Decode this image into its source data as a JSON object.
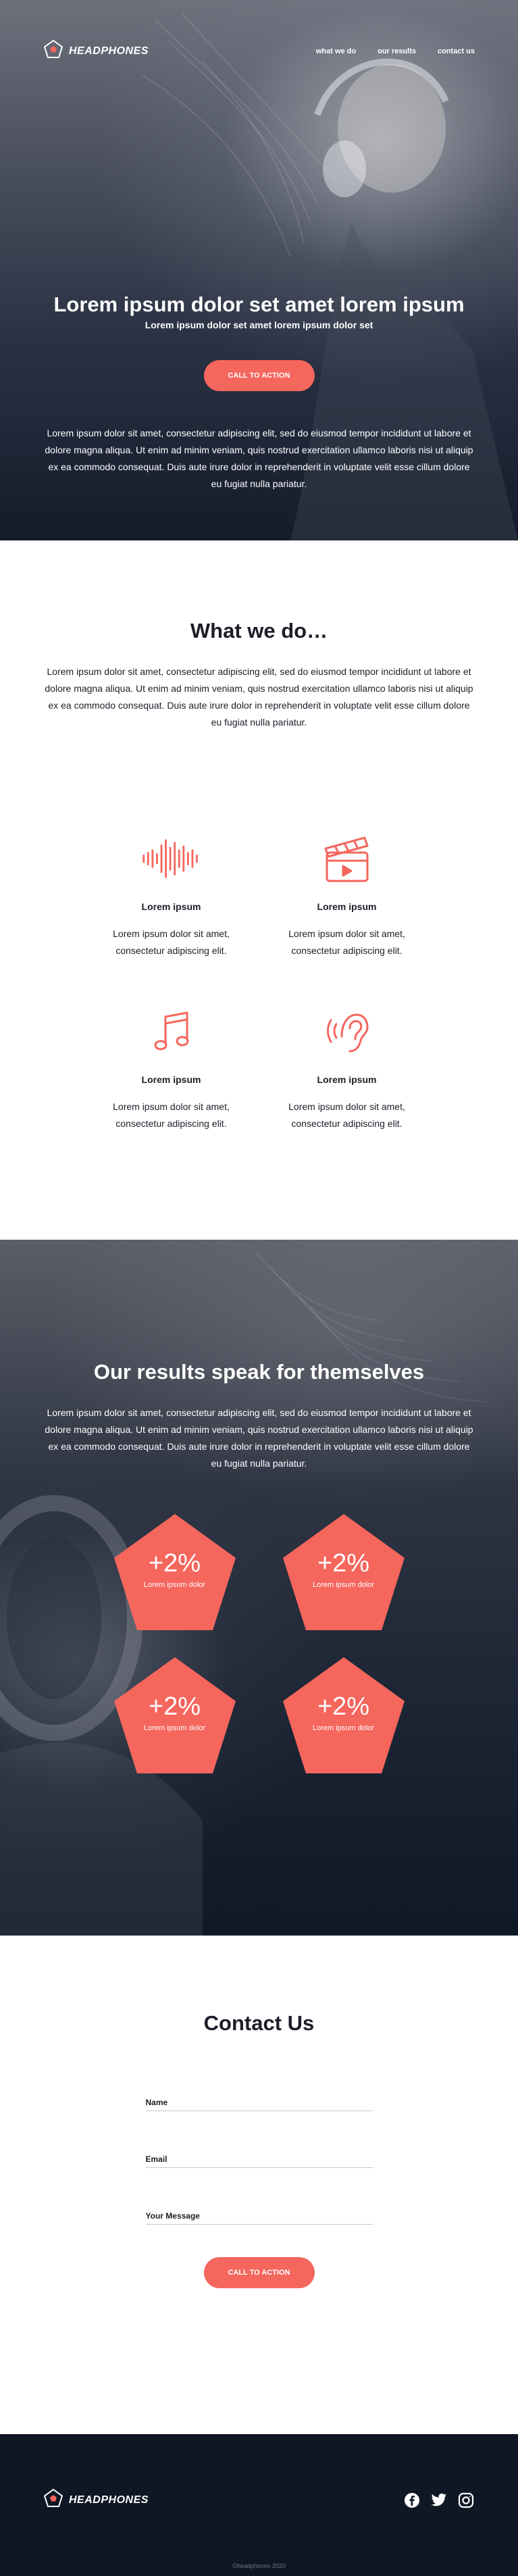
{
  "colors": {
    "accent": "#f5665d",
    "dark": "#141c2b",
    "text": "#1b1e28",
    "white": "#ffffff"
  },
  "brand": {
    "name": "HEADPHONES",
    "logo_icon": "pentagon-logo-icon"
  },
  "nav": {
    "links": [
      {
        "label": "what we do"
      },
      {
        "label": "our results"
      },
      {
        "label": "contact us"
      }
    ]
  },
  "hero": {
    "title": "Lorem ipsum dolor set amet lorem ipsum",
    "subtitle": "Lorem ipsum dolor set amet lorem ipsum dolor set",
    "cta": "CALL TO ACTION",
    "text": "Lorem ipsum dolor sit amet, consectetur adipiscing elit, sed do eiusmod tempor incididunt ut labore et dolore magna aliqua. Ut enim ad minim veniam, quis nostrud exercitation ullamco laboris nisi ut aliquip ex ea commodo consequat. Duis aute irure dolor in reprehenderit in voluptate velit esse cillum dolore eu fugiat nulla pariatur."
  },
  "what": {
    "title": "What we do…",
    "text": "Lorem ipsum dolor sit amet, consectetur adipiscing elit, sed do eiusmod tempor incididunt ut labore et dolore magna aliqua. Ut enim ad minim veniam, quis nostrud exercitation ullamco laboris nisi ut aliquip ex ea commodo consequat. Duis aute irure dolor in reprehenderit in voluptate velit esse cillum dolore eu fugiat nulla pariatur.",
    "features": [
      {
        "icon": "sound-wave-icon",
        "title": "Lorem ipsum",
        "text": "Lorem ipsum dolor sit amet, consectetur adipiscing elit."
      },
      {
        "icon": "clapperboard-icon",
        "title": "Lorem ipsum",
        "text": "Lorem ipsum dolor sit amet, consectetur adipiscing elit."
      },
      {
        "icon": "music-note-icon",
        "title": "Lorem ipsum",
        "text": "Lorem ipsum dolor sit amet, consectetur adipiscing elit."
      },
      {
        "icon": "ear-icon",
        "title": "Lorem ipsum",
        "text": "Lorem ipsum dolor sit amet, consectetur adipiscing elit."
      }
    ]
  },
  "results": {
    "title": "Our results speak for themselves",
    "text": "Lorem ipsum dolor sit amet, consectetur adipiscing elit, sed do eiusmod tempor incididunt ut labore et dolore magna aliqua. Ut enim ad minim veniam, quis nostrud exercitation ullamco laboris nisi ut aliquip ex ea commodo consequat. Duis aute irure dolor in reprehenderit in voluptate velit esse cillum dolore eu fugiat nulla pariatur.",
    "stats": [
      {
        "value": "+2%",
        "label": "Lorem ipsum dolor"
      },
      {
        "value": "+2%",
        "label": "Lorem ipsum dolor"
      },
      {
        "value": "+2%",
        "label": "Lorem ipsum dolor"
      },
      {
        "value": "+2%",
        "label": "Lorem ipsum dolor"
      }
    ]
  },
  "contact": {
    "title": "Contact Us",
    "fields": [
      {
        "label": "Name",
        "value": ""
      },
      {
        "label": "Email",
        "value": ""
      },
      {
        "label": "Your Message",
        "value": ""
      }
    ],
    "cta": "CALL TO ACTION"
  },
  "footer": {
    "socials": [
      {
        "icon": "facebook-icon"
      },
      {
        "icon": "twitter-icon"
      },
      {
        "icon": "instagram-icon"
      }
    ],
    "copyright": "©headphones 2020"
  }
}
